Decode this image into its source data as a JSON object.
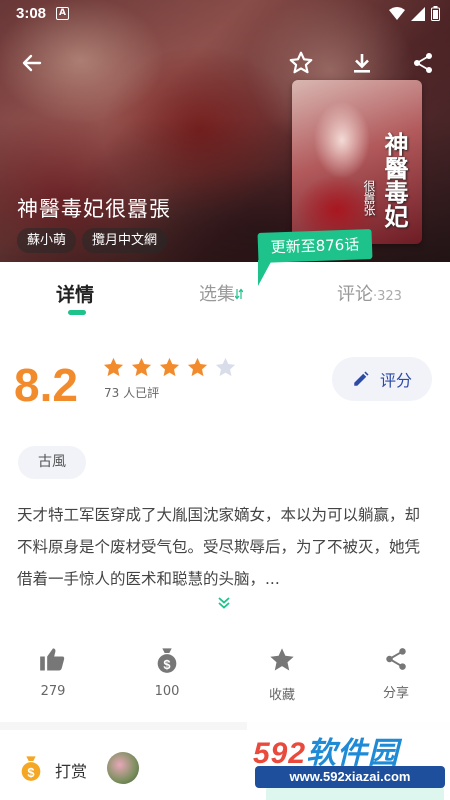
{
  "status_bar": {
    "time": "3:08",
    "notification_letter": "A"
  },
  "header": {
    "back_icon": "arrow-left-icon",
    "actions": [
      "star-outline-icon",
      "download-icon",
      "share-icon"
    ]
  },
  "book": {
    "title": "神醫毒妃很囂張",
    "author": "蘇小萌",
    "publisher": "攬月中文網",
    "cover_title": "神醫毒妃",
    "cover_subtitle": "很囂张",
    "update_badge": "更新至876话"
  },
  "tabs": [
    {
      "label": "详情",
      "active": true
    },
    {
      "label": "选集",
      "active": false
    },
    {
      "label": "评论",
      "count": "·323",
      "active": false
    }
  ],
  "rating": {
    "score": "8.2",
    "stars": 4,
    "max_stars": 5,
    "count_text": "73 人已評",
    "rate_button": "评分"
  },
  "genre": "古風",
  "description": "天才特工军医穿成了大胤国沈家嫡女，本以为可以躺赢，却不料原身是个废材受气包。受尽欺辱后，为了不被灭，她凭借着一手惊人的医术和聪慧的头脑，...",
  "actions": [
    {
      "icon": "thumbs-up-icon",
      "label": "279"
    },
    {
      "icon": "money-bag-icon",
      "label": "100"
    },
    {
      "icon": "star-icon",
      "label": "收藏"
    },
    {
      "icon": "share-icon",
      "label": "分享"
    }
  ],
  "reward": {
    "label": "打赏"
  },
  "watermark": {
    "brand_num": "592",
    "brand_text": "软件园",
    "url": "www.592xiazai.com"
  },
  "colors": {
    "accent": "#1ec28b",
    "score": "#f28b2c",
    "rate_text": "#2d4aa8",
    "star": "#f28b2c"
  }
}
